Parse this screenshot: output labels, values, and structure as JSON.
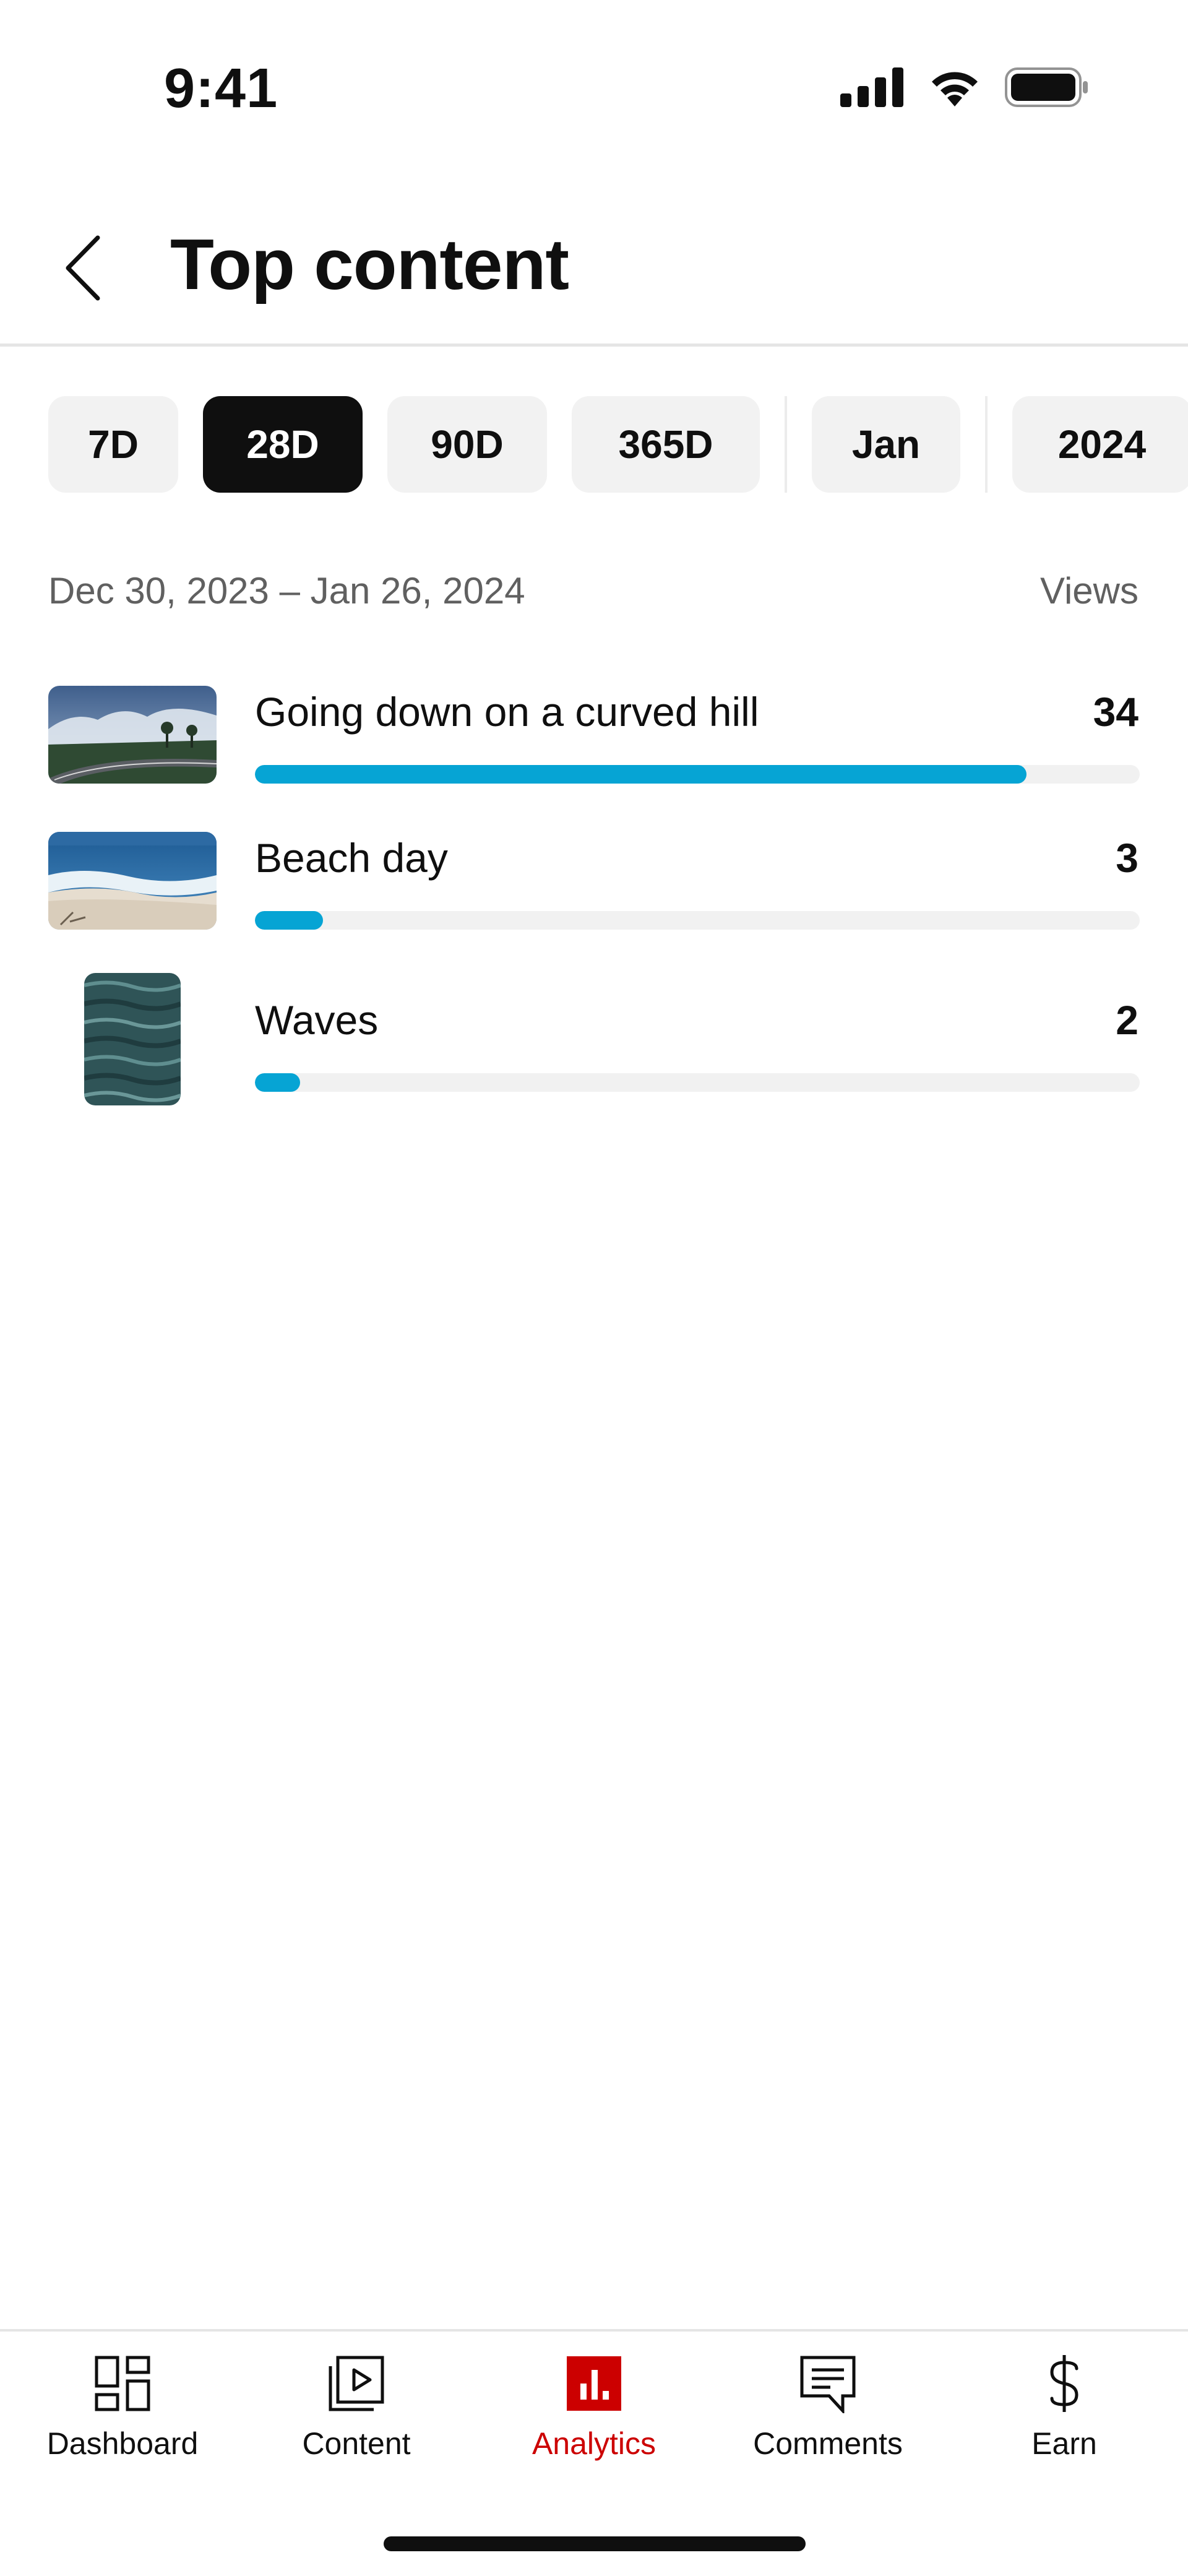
{
  "status_bar": {
    "time": "9:41",
    "icons": [
      "cellular-signal-icon",
      "wifi-icon",
      "battery-icon"
    ]
  },
  "header": {
    "title": "Top content",
    "back_icon": "chevron-left-icon"
  },
  "filters": {
    "chips": [
      {
        "label": "7D",
        "selected": false
      },
      {
        "label": "28D",
        "selected": true
      },
      {
        "label": "90D",
        "selected": false
      },
      {
        "label": "365D",
        "selected": false
      },
      {
        "label": "Jan",
        "selected": false
      },
      {
        "label": "2024",
        "selected": false
      }
    ]
  },
  "range": {
    "dates": "Dec 30, 2023 – Jan 26, 2024",
    "metric_label": "Views"
  },
  "content": {
    "items": [
      {
        "title": "Going down on a curved hill",
        "views": "34",
        "bar_fraction": 0.872,
        "thumbnail": "curved-road-hill-thumbnail"
      },
      {
        "title": "Beach day",
        "views": "3",
        "bar_fraction": 0.077,
        "thumbnail": "beach-waves-thumbnail"
      },
      {
        "title": "Waves",
        "views": "2",
        "bar_fraction": 0.051,
        "thumbnail": "ocean-waves-vertical-thumbnail"
      }
    ]
  },
  "bottom_nav": {
    "items": [
      {
        "label": "Dashboard",
        "icon": "dashboard-icon",
        "active": false
      },
      {
        "label": "Content",
        "icon": "content-play-icon",
        "active": false
      },
      {
        "label": "Analytics",
        "icon": "analytics-bar-icon",
        "active": true
      },
      {
        "label": "Comments",
        "icon": "comments-icon",
        "active": false
      },
      {
        "label": "Earn",
        "icon": "dollar-icon",
        "active": false
      }
    ]
  },
  "colors": {
    "accent_red": "#cc0000",
    "bar_blue": "#06a4d4",
    "chip_selected_bg": "#0f0f0f",
    "chip_bg": "#f2f2f2",
    "secondary_text": "#606060"
  }
}
